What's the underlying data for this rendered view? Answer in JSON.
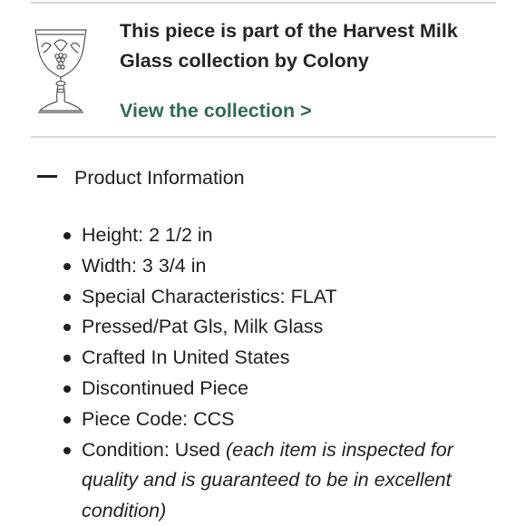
{
  "collection": {
    "image_icon": "goblet-icon",
    "text": "This piece is part of the Harvest Milk Glass collection by Colony",
    "link_label": "View the collection >",
    "link_color": "#2f6a57"
  },
  "product_info": {
    "toggle_icon": "minus-icon",
    "title": "Product Information",
    "items": [
      "Height: 2 1/2 in",
      "Width: 3 3/4 in",
      "Special Characteristics: FLAT",
      "Pressed/Pat Gls, Milk Glass",
      "Crafted In United States",
      "Discontinued Piece",
      "Piece Code: CCS"
    ],
    "condition": {
      "label": "Condition: Used ",
      "note": "(each item is inspected for quality and is guaranteed to be in excellent condition)"
    }
  }
}
